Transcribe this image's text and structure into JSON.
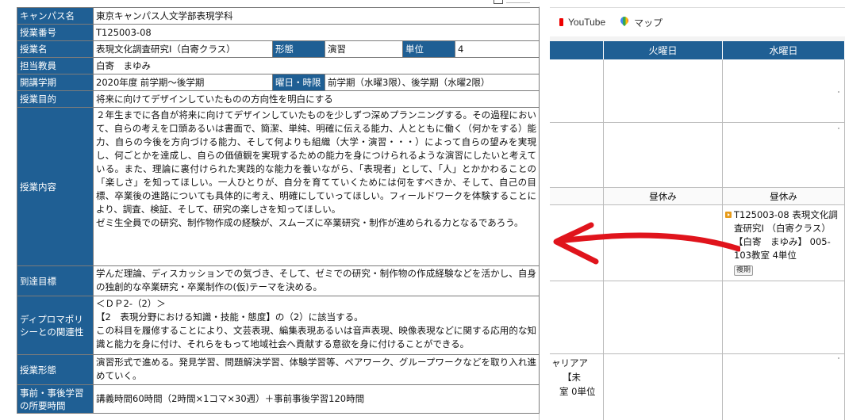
{
  "browser": {
    "bookmarks": [
      {
        "label": "YouTube",
        "icon": "youtube-icon"
      },
      {
        "label": "マップ",
        "icon": "maps-icon"
      }
    ]
  },
  "timetable": {
    "headers": [
      "",
      "火曜日",
      "水曜日"
    ],
    "lunch": [
      "",
      "昼休み",
      "昼休み"
    ],
    "course": {
      "text": "T125003-08 表現文化調査研究I （白寄クラス） 【白寄　まゆみ】 005-103教室 4単位",
      "badge": "複期"
    },
    "partial_cell": [
      "ャリアア",
      "【未",
      "室 0単位"
    ]
  },
  "syllabus": {
    "rows": [
      {
        "label": "キャンパス名",
        "value": "東京キャンパス人文学部表現学科"
      },
      {
        "label": "授業番号",
        "value": "T125003-08"
      },
      {
        "label": "授業名",
        "value": "表現文化調査研究I（白寄クラス）",
        "extra1_label": "形態",
        "extra1_value": "演習",
        "extra2_label": "単位",
        "extra2_value": "4"
      },
      {
        "label": "担当教員",
        "value": "白寄　まゆみ"
      },
      {
        "label": "開講学期",
        "value": "2020年度 前学期～後学期",
        "extra_label": "曜日・時限",
        "extra_value": "前学期（水曜3限）、後学期（水曜2限）"
      },
      {
        "label": "授業目的",
        "value": "将来に向けてデザインしていたものの方向性を明白にする"
      },
      {
        "label": "授業内容",
        "paragraphs": [
          "２年生までに各自が将来に向けてデザインしていたものを少しずつ深めプランニングする。その過程において、自らの考えを口頭あるいは書面で、簡潔、単純、明確に伝える能力、人とともに働く（何かをする）能力、自らの今後を方向づける能力、そして何よりも組織（大学・演習・・・）によって自らの望みを実現し、何ごとかを達成し、自らの価値観を実現するための能力を身につけられるような演習にしたいと考えている。また、理論に裏付けられた実践的な能力を養いながら、「表現者」として、「人」とかかわることの「楽しさ」を知ってほしい。一人ひとりが、自分を育てていくためには何をすべきか、そして、自己の目標、卒業後の進路についても具体的に考え、明確にしていってほしい。フィールドワークを体験することにより、調査、検証、そして、研究の楽しさを知ってほしい。",
          "ゼミ生全員での研究、制作物作成の経験が、スムーズに卒業研究・制作が進められる力となるであろう。"
        ]
      },
      {
        "label": "到達目標",
        "value": "学んだ理論、ディスカッションでの気づき、そして、ゼミでの研究・制作物の作成経験などを活かし、自身の独創的な卒業研究・卒業制作の(仮)テーマを決める。"
      },
      {
        "label": "ディプロマポリシーとの関連性",
        "paragraphs": [
          "＜ＤＰ2-（2）＞",
          "【2　表現分野における知識・技能・態度】の（2）に該当する。",
          "この科目を履修することにより、文芸表現、編集表現あるいは音声表現、映像表現などに関する応用的な知識と能力を身に付け、それらをもって地域社会へ貢献する意欲を身に付けることができる。"
        ]
      },
      {
        "label": "授業形態",
        "value": "演習形式で進める。発見学習、問題解決学習、体験学習等、ペアワーク、グループワークなどを取り入れ進めていく。"
      },
      {
        "label": "事前・事後学習の所要時間",
        "value": "講義時間60時間（2時間×1コマ×30週）＋事前事後学習120時間"
      }
    ]
  },
  "colors": {
    "header_blue": "#1f5f94",
    "arrow_red": "#e0141c",
    "course_icon": "#e79b1a"
  }
}
